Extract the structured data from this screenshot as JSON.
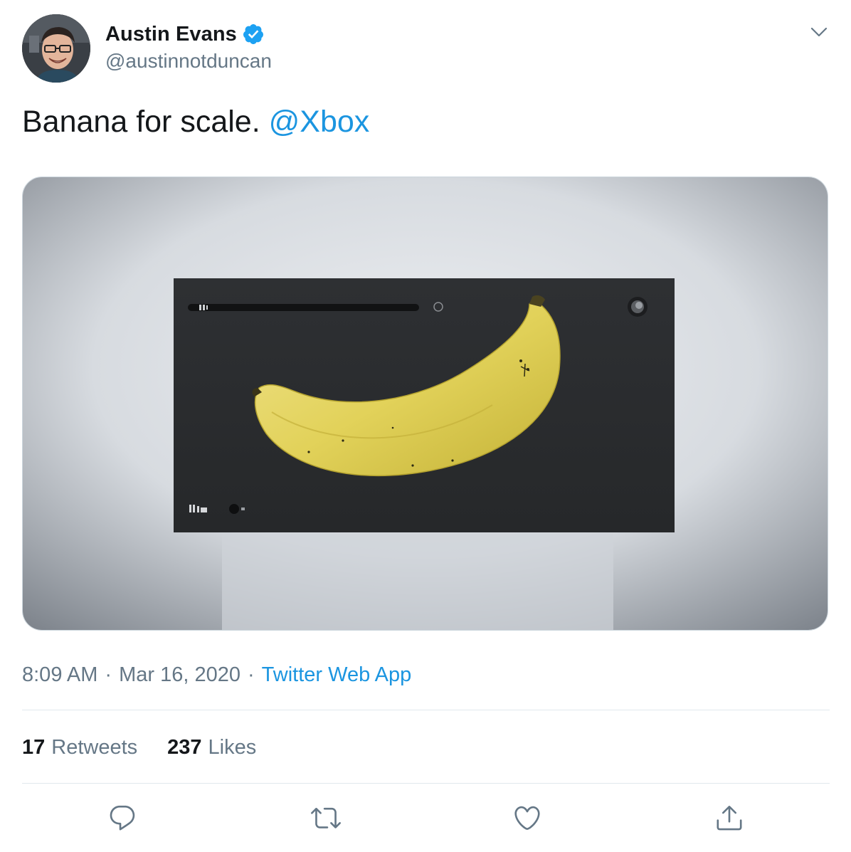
{
  "author": {
    "display_name": "Austin Evans",
    "handle": "@austinnotduncan",
    "verified": true
  },
  "tweet": {
    "text": "Banana for scale.",
    "mention": "@Xbox"
  },
  "meta": {
    "time": "8:09 AM",
    "date": "Mar 16, 2020",
    "source": "Twitter Web App",
    "separator": "·"
  },
  "stats": {
    "retweets_count": "17",
    "retweets_label": "Retweets",
    "likes_count": "237",
    "likes_label": "Likes"
  },
  "colors": {
    "link": "#1b95e0",
    "secondary_text": "#657786",
    "primary_text": "#14171a",
    "divider": "#e1e8ed"
  },
  "icons": {
    "menu": "chevron-down-icon",
    "verified": "verified-badge-icon",
    "reply": "reply-icon",
    "retweet": "retweet-icon",
    "like": "heart-icon",
    "share": "share-icon"
  }
}
